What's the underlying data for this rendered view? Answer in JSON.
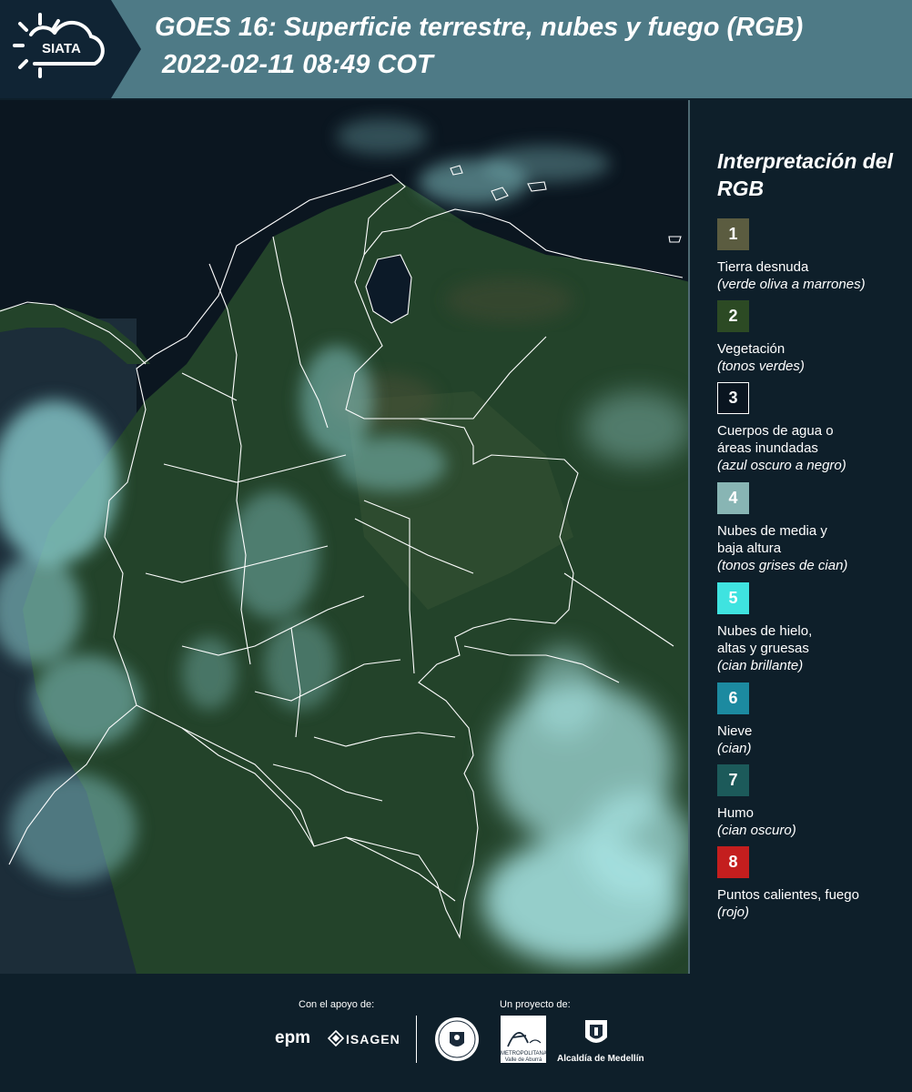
{
  "header": {
    "logo_text": "SIATA",
    "title_line1": "GOES 16: Superficie terrestre, nubes y fuego (RGB)",
    "title_line2": "2022-02-11 08:49 COT"
  },
  "legend": {
    "title": "Interpretación del RGB",
    "items": [
      {
        "num": "1",
        "name": "Tierra desnuda",
        "desc": "(verde oliva a marrones)",
        "color": "#5b5c40",
        "text_color": "#ffffff"
      },
      {
        "num": "2",
        "name": "Vegetación",
        "desc": "(tonos verdes)",
        "color": "#2c4a24",
        "text_color": "#ffffff"
      },
      {
        "num": "3",
        "name": "Cuerpos de agua o\náreas inundadas",
        "desc": "(azul oscuro a negro)",
        "color": "#0a1520",
        "text_color": "#ffffff"
      },
      {
        "num": "4",
        "name": "Nubes de media y\nbaja altura",
        "desc": "(tonos grises de cian)",
        "color": "#88b5b4",
        "text_color": "#ffffff"
      },
      {
        "num": "5",
        "name": "Nubes de hielo,\naltas y gruesas",
        "desc": "(cian brillante)",
        "color": "#3fe3e0",
        "text_color": "#ffffff"
      },
      {
        "num": "6",
        "name": "Nieve",
        "desc": "(cian)",
        "color": "#1c8aa0",
        "text_color": "#ffffff"
      },
      {
        "num": "7",
        "name": "Humo",
        "desc": "(cian oscuro)",
        "color": "#1c5a5a",
        "text_color": "#ffffff"
      },
      {
        "num": "8",
        "name": "Puntos calientes, fuego",
        "desc": "(rojo)",
        "color": "#c41e1e",
        "text_color": "#ffffff"
      }
    ]
  },
  "footer": {
    "support_label": "Con el apoyo de:",
    "project_label": "Un proyecto de:",
    "epm": "epm",
    "isagen": "ISAGEN",
    "amva_text": "METROPOLITANA Valle de Aburrá",
    "amva_script": "Área",
    "alcaldia": "Alcaldía de Medellín"
  },
  "colors": {
    "header_bg": "#4e7a86",
    "panel_bg": "#0e1f2a",
    "vegetation": "#2b4a28",
    "cloud": "#8fd4d6"
  }
}
